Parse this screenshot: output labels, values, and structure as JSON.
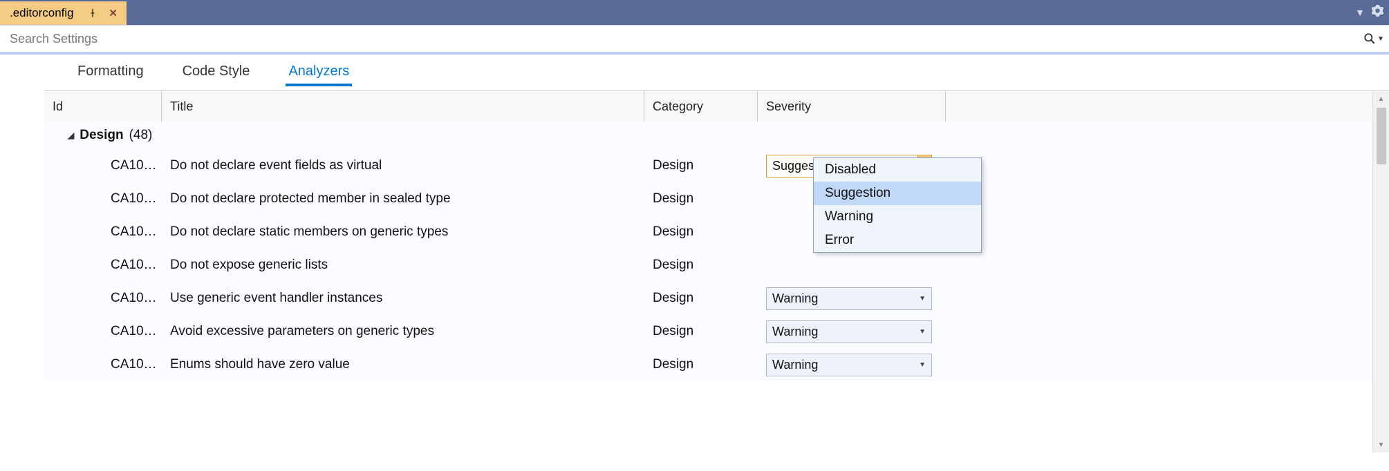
{
  "titlebar": {
    "tab_name": ".editorconfig"
  },
  "search": {
    "placeholder": "Search Settings"
  },
  "tabs": [
    {
      "label": "Formatting",
      "active": false
    },
    {
      "label": "Code Style",
      "active": false
    },
    {
      "label": "Analyzers",
      "active": true
    }
  ],
  "grid": {
    "headers": {
      "id": "Id",
      "title": "Title",
      "category": "Category",
      "severity": "Severity"
    },
    "group": {
      "name": "Design",
      "count": "(48)"
    },
    "rows": [
      {
        "id": "CA10…",
        "title": "Do not declare event fields as virtual",
        "category": "Design",
        "severity": "Suggestion",
        "active": true
      },
      {
        "id": "CA10…",
        "title": "Do not declare protected member in sealed type",
        "category": "Design",
        "severity": "",
        "active": false
      },
      {
        "id": "CA10…",
        "title": "Do not declare static members on generic types",
        "category": "Design",
        "severity": "",
        "active": false
      },
      {
        "id": "CA10…",
        "title": "Do not expose generic lists",
        "category": "Design",
        "severity": "",
        "active": false
      },
      {
        "id": "CA10…",
        "title": "Use generic event handler instances",
        "category": "Design",
        "severity": "Warning",
        "active": false
      },
      {
        "id": "CA10…",
        "title": "Avoid excessive parameters on generic types",
        "category": "Design",
        "severity": "Warning",
        "active": false
      },
      {
        "id": "CA10…",
        "title": "Enums should have zero value",
        "category": "Design",
        "severity": "Warning",
        "active": false
      }
    ]
  },
  "severity_options": [
    "Disabled",
    "Suggestion",
    "Warning",
    "Error"
  ],
  "severity_selected": "Suggestion"
}
